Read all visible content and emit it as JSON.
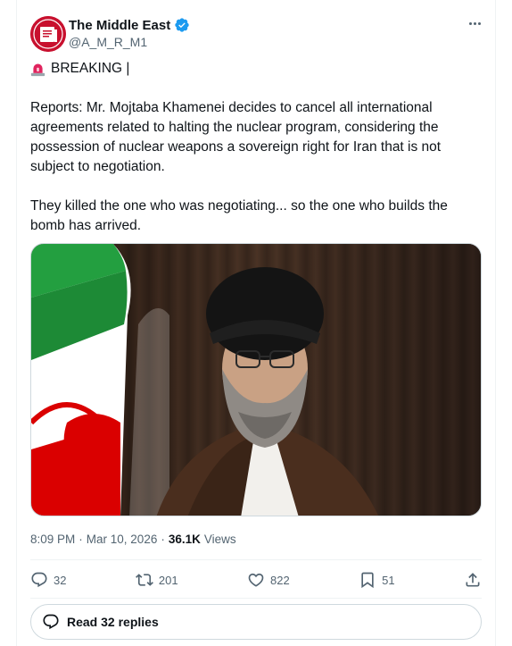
{
  "author": {
    "name": "The Middle East",
    "handle": "@A_M_R_M1",
    "avatar_text": "NEWS"
  },
  "tweet": {
    "breaking_label": "BREAKING |",
    "paragraph_1": "Reports: Mr. Mojtaba Khamenei decides to cancel all international agreements related to halting the nuclear program, considering the possession of nuclear weapons a sovereign right for Iran that is not subject to negotiation.",
    "paragraph_2": "They killed the one who was negotiating... so the one who builds the bomb has arrived."
  },
  "meta": {
    "time": "8:09 PM",
    "separator": "·",
    "date": "Mar 10, 2026",
    "views_count": "36.1K",
    "views_label": "Views"
  },
  "actions": {
    "replies": "32",
    "reposts": "201",
    "likes": "822",
    "bookmarks": "51"
  },
  "read_replies_label": "Read 32 replies",
  "colors": {
    "verified": "#1d9bf0",
    "muted_text": "#536471",
    "avatar_bg": "#c8102e",
    "siren": "#e0245e"
  },
  "icons": [
    "verified-badge-icon",
    "more-icon",
    "siren-icon",
    "reply-icon",
    "repost-icon",
    "like-icon",
    "bookmark-icon",
    "share-icon",
    "reply-bubble-icon"
  ]
}
